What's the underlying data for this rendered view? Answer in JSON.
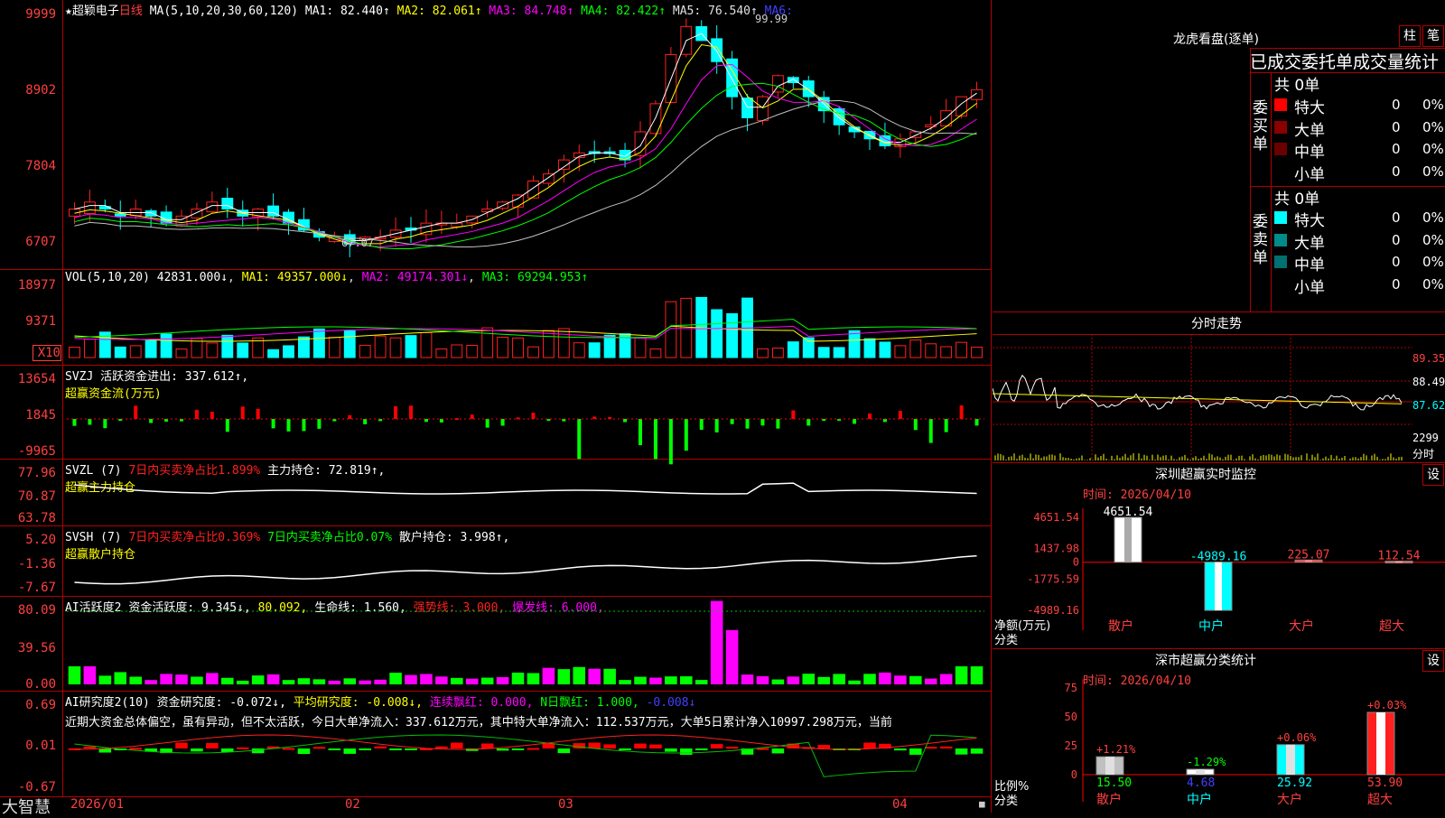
{
  "app": {
    "brand": "大智慧",
    "title_star": "★",
    "stock_name": "超颖电子",
    "period": "日线"
  },
  "main": {
    "ma_header": "MA(5,10,20,30,60,120)",
    "ma": [
      {
        "label": "MA1: 82.440↑",
        "color": "#ffffff"
      },
      {
        "label": "MA2: 82.061↑",
        "color": "#ffff00"
      },
      {
        "label": "MA3: 84.748↑",
        "color": "#ff00ff"
      },
      {
        "label": "MA4: 82.422↑",
        "color": "#00ff00"
      },
      {
        "label": "MA5: 76.540↑",
        "color": "#c0c0c0"
      },
      {
        "label": "MA6:",
        "color": "#0000ff"
      }
    ],
    "yticks": [
      "9999",
      "8902",
      "7804",
      "6707"
    ],
    "high_label": "99.99",
    "low_label": "67.07",
    "x_labels": [
      "2026/01",
      "02",
      "03",
      "04"
    ]
  },
  "vol": {
    "header": "VOL(5,10,20)",
    "value": "42831.000↓",
    "ma": [
      {
        "label": "MA1: 49357.000↓",
        "color": "#ffff00"
      },
      {
        "label": "MA2: 49174.301↓",
        "color": "#ff00ff"
      },
      {
        "label": "MA3: 69294.953↑",
        "color": "#00ff00"
      }
    ],
    "yticks": [
      "18977",
      "9371"
    ],
    "unit": "X10"
  },
  "svzj": {
    "line1": "SVZJ  活跃资金进出: 337.612↑,",
    "line2": "超赢资金流(万元)",
    "yticks": [
      "13654",
      "1845",
      "-9965"
    ]
  },
  "svzl": {
    "name": "SVZL (7)",
    "a": "7日内买卖净占比1.899%",
    "b": "主力持仓: 72.819↑,",
    "line2": "超赢主力持仓",
    "yticks": [
      "77.96",
      "70.87",
      "63.78"
    ]
  },
  "svsh": {
    "name": "SVSH (7)",
    "a": "7日内买卖净占比0.369%",
    "b": "7日内买卖净占比0.07%",
    "c": "散户持仓: 3.998↑,",
    "line2": "超赢散户持仓",
    "yticks": [
      "5.20",
      "-1.36",
      "-7.67"
    ]
  },
  "ai1": {
    "name": "AI活跃度2",
    "a": "资金活跃度: 9.345↓,",
    "b": "80.092,",
    "c": "生命线: 1.560,",
    "d": "强势线: 3.000,",
    "e": "爆发线: 6.000,",
    "yticks": [
      "80.09",
      "39.56",
      "0.00"
    ]
  },
  "ai2": {
    "name": "AI研究度2(10)",
    "a": "资金研究度: -0.072↓,",
    "b": "平均研究度: -0.008↓,",
    "c": "连续飘红: 0.000,",
    "d": "N日飘红: 1.000,",
    "e": "-0.008↓",
    "comment": "近期大资金总体偏空，虽有异动，但不太活跃，今日大单净流入：337.612万元，其中特大单净流入：112.537万元，大单5日累计净入10997.298万元，当前",
    "yticks": [
      "0.69",
      "0.01",
      "-0.67"
    ]
  },
  "right": {
    "lhb": {
      "title": "龙虎看盘(逐单)",
      "btn1": "柱",
      "btn2": "笔",
      "subtitle": "已成交委托单成交量统计",
      "buy_label": "委买单",
      "sell_label": "委卖单",
      "buy_total": "共 0单",
      "sell_total": "共 0单",
      "buy_rows": [
        {
          "name": "特大",
          "color": "#ff0000",
          "n": "0",
          "p": "0%"
        },
        {
          "name": "大单",
          "color": "#8b0000",
          "n": "0",
          "p": "0%"
        },
        {
          "name": "中单",
          "color": "#6b0000",
          "n": "0",
          "p": "0%"
        },
        {
          "name": "小单",
          "color": "#000000",
          "n": "0",
          "p": "0%"
        }
      ],
      "sell_rows": [
        {
          "name": "特大",
          "color": "#00ffff",
          "n": "0",
          "p": "0%"
        },
        {
          "name": "大单",
          "color": "#008b8b",
          "n": "0",
          "p": "0%"
        },
        {
          "name": "中单",
          "color": "#007070",
          "n": "0",
          "p": "0%"
        },
        {
          "name": "小单",
          "color": "#000000",
          "n": "0",
          "p": "0%"
        }
      ]
    },
    "fenshi": {
      "title": "分时走势",
      "yticks": [
        "89.35",
        "88.49",
        "87.62",
        "2299"
      ],
      "unit": "分时"
    },
    "monitor": {
      "title": "深圳超赢实时监控",
      "btn": "设",
      "time": "时间: 2026/04/10",
      "yticks": [
        "4651.54",
        "1437.98",
        "0",
        "-1775.59",
        "-4989.16"
      ],
      "ylabel": "净额(万元)",
      "xlabel": "分类"
    },
    "stats": {
      "title": "深市超赢分类统计",
      "btn": "设",
      "time": "时间: 2026/04/10",
      "yticks": [
        "75",
        "50",
        "25",
        "0"
      ],
      "ylabel": "比例%",
      "xlabel": "分类"
    }
  },
  "chart_data": [
    {
      "type": "bar",
      "title": "深圳超赢实时监控",
      "ylabel": "净额(万元)",
      "xlabel": "分类",
      "categories": [
        "散户",
        "中户",
        "大户",
        "超大"
      ],
      "values": [
        4651.54,
        -4989.16,
        225.07,
        112.54
      ],
      "value_labels": [
        "4651.54",
        "-4989.16",
        "225.07",
        "112.54"
      ],
      "colors": [
        "#ffffff",
        "#00ffff",
        "#ff4040",
        "#ff4040"
      ],
      "ylim": [
        -4989.16,
        4651.54
      ]
    },
    {
      "type": "bar",
      "title": "深市超赢分类统计",
      "ylabel": "比例%",
      "xlabel": "分类",
      "categories": [
        "散户",
        "中户",
        "大户",
        "超大"
      ],
      "values": [
        15.5,
        4.68,
        25.92,
        53.9
      ],
      "value_labels": [
        "15.50",
        "4.68",
        "25.92",
        "53.90"
      ],
      "change_labels": [
        "+1.21%",
        "-1.29%",
        "+0.06%",
        "+0.03%"
      ],
      "ylim": [
        0,
        75
      ]
    }
  ]
}
